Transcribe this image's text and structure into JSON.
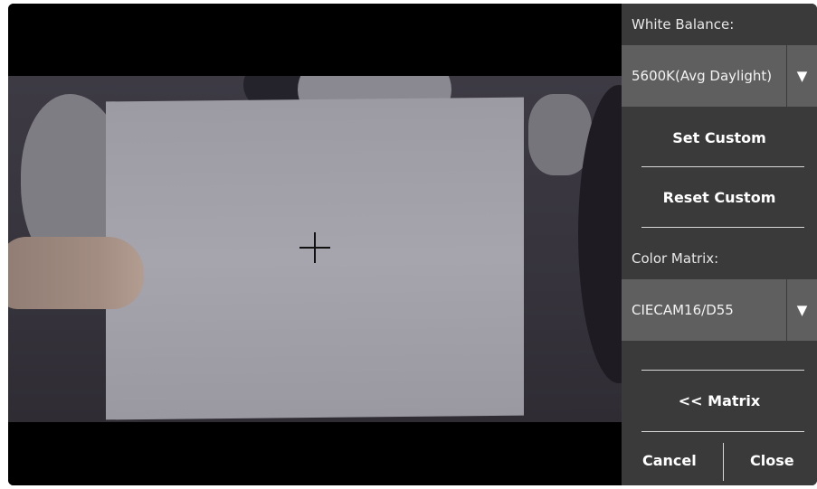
{
  "panel": {
    "white_balance_label": "White Balance:",
    "white_balance_value": "5600K(Avg Daylight)",
    "set_custom_label": "Set Custom",
    "reset_custom_label": "Reset Custom",
    "color_matrix_label": "Color Matrix:",
    "color_matrix_value": "CIECAM16/D55",
    "matrix_button_label": "<< Matrix",
    "cancel_label": "Cancel",
    "close_label": "Close",
    "dropdown_arrow": "▼"
  },
  "icons": {
    "crosshair": "crosshair-icon",
    "dropdown_arrow": "triangle-down-icon"
  },
  "colors": {
    "panel_bg": "#3a3a3a",
    "dropdown_bg": "#5f5f5f",
    "viewport_bg": "#000000"
  }
}
